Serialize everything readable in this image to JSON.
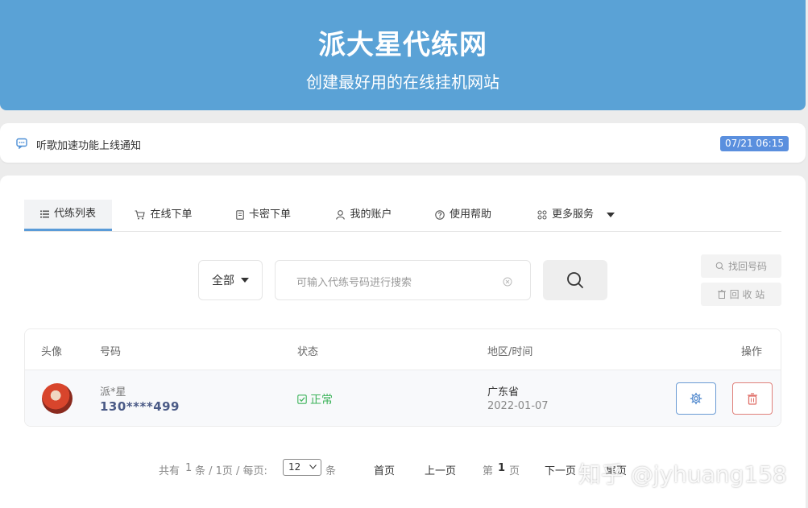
{
  "header": {
    "title": "派大星代练网",
    "subtitle": "创建最好用的在线挂机网站"
  },
  "notice": {
    "icon": "message-icon",
    "text": "听歌加速功能上线通知",
    "time": "07/21 06:15"
  },
  "tabs": [
    {
      "label": "代练列表",
      "icon": "list-icon",
      "active": true
    },
    {
      "label": "在线下单",
      "icon": "cart-icon"
    },
    {
      "label": "卡密下单",
      "icon": "document-icon"
    },
    {
      "label": "我的账户",
      "icon": "user-icon"
    },
    {
      "label": "使用帮助",
      "icon": "help-icon"
    },
    {
      "label": "更多服务",
      "icon": "grid-icon"
    }
  ],
  "search": {
    "filter_value": "全部",
    "placeholder": "可输入代练号码进行搜索"
  },
  "side_buttons": {
    "recover": "找回号码",
    "recycle": "回 收 站"
  },
  "table": {
    "headers": {
      "avatar": "头像",
      "number": "号码",
      "status": "状态",
      "region_time": "地区/时间",
      "actions": "操作"
    },
    "rows": [
      {
        "name": "派*星",
        "phone": "130****499",
        "status": "正常",
        "region": "广东省",
        "date": "2022-01-07"
      }
    ]
  },
  "pagination": {
    "total_prefix": "共有",
    "total": "1",
    "total_suffix": "条 / 1页 / 每页:",
    "per_page": "12",
    "per_page_unit": "条",
    "first": "首页",
    "prev": "上一页",
    "page_prefix": "第",
    "current_page": "1",
    "page_suffix": "页",
    "next": "下一页",
    "last": "尾页"
  },
  "watermark": "知乎 @jyhuang158",
  "colors": {
    "header": "#5aa2d6",
    "accent": "#5a9bd8",
    "status_ok": "#3cb35a",
    "danger": "#e0807a"
  }
}
